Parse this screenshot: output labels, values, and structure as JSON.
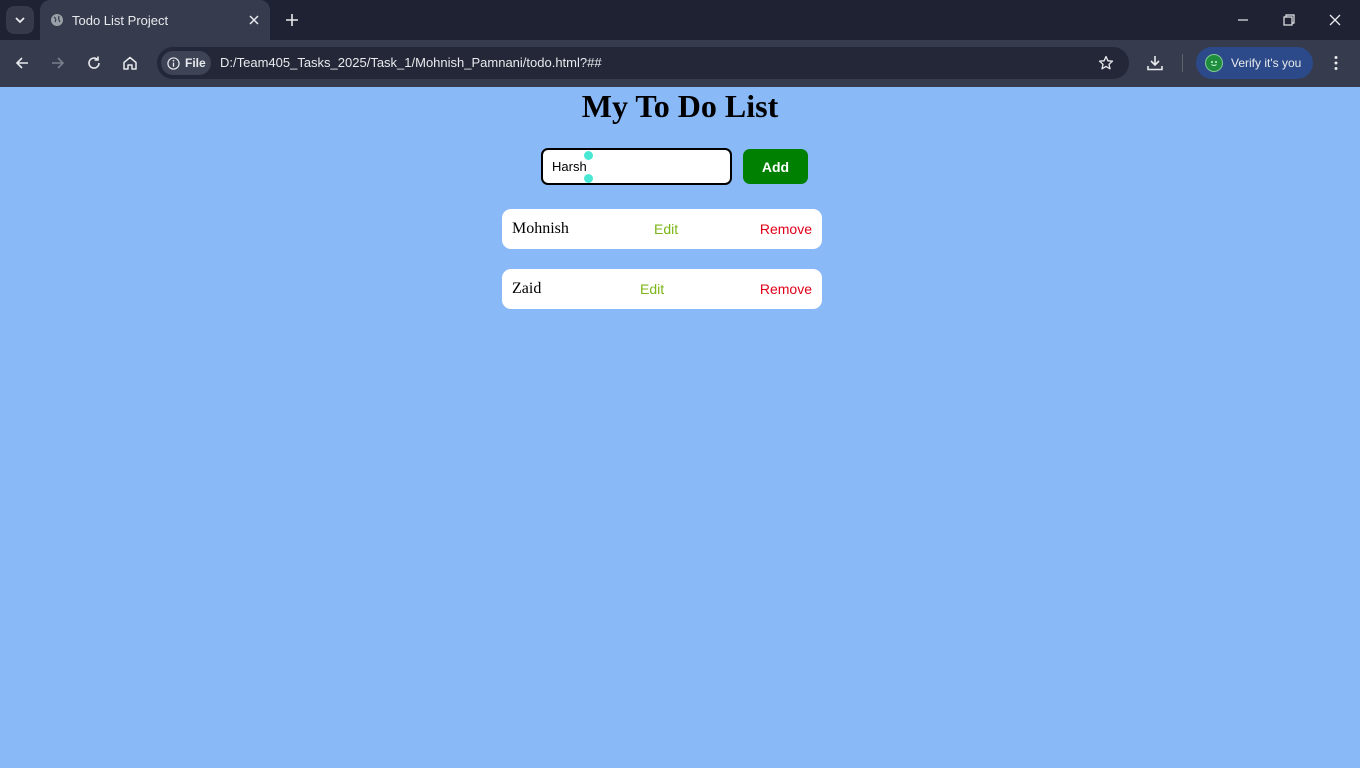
{
  "browser": {
    "tab": {
      "title": "Todo List Project"
    },
    "address": {
      "site_chip": "File",
      "url": "D:/Team405_Tasks_2025/Task_1/Mohnish_Pamnani/todo.html?##"
    },
    "profile": {
      "label": "Verify it's you"
    }
  },
  "page": {
    "title": "My To Do List",
    "input": {
      "value": "Harsh"
    },
    "add_label": "Add",
    "items": [
      {
        "text": "Mohnish",
        "edit_label": "Edit",
        "remove_label": "Remove"
      },
      {
        "text": "Zaid",
        "edit_label": "Edit",
        "remove_label": "Remove"
      }
    ]
  },
  "colors": {
    "page_background": "#8ab9f7",
    "add_button": "#008000",
    "edit_text": "#7cb518",
    "remove_text": "#e0001a",
    "chrome_dark": "#1e2233",
    "chrome_toolbar": "#363b4d"
  }
}
